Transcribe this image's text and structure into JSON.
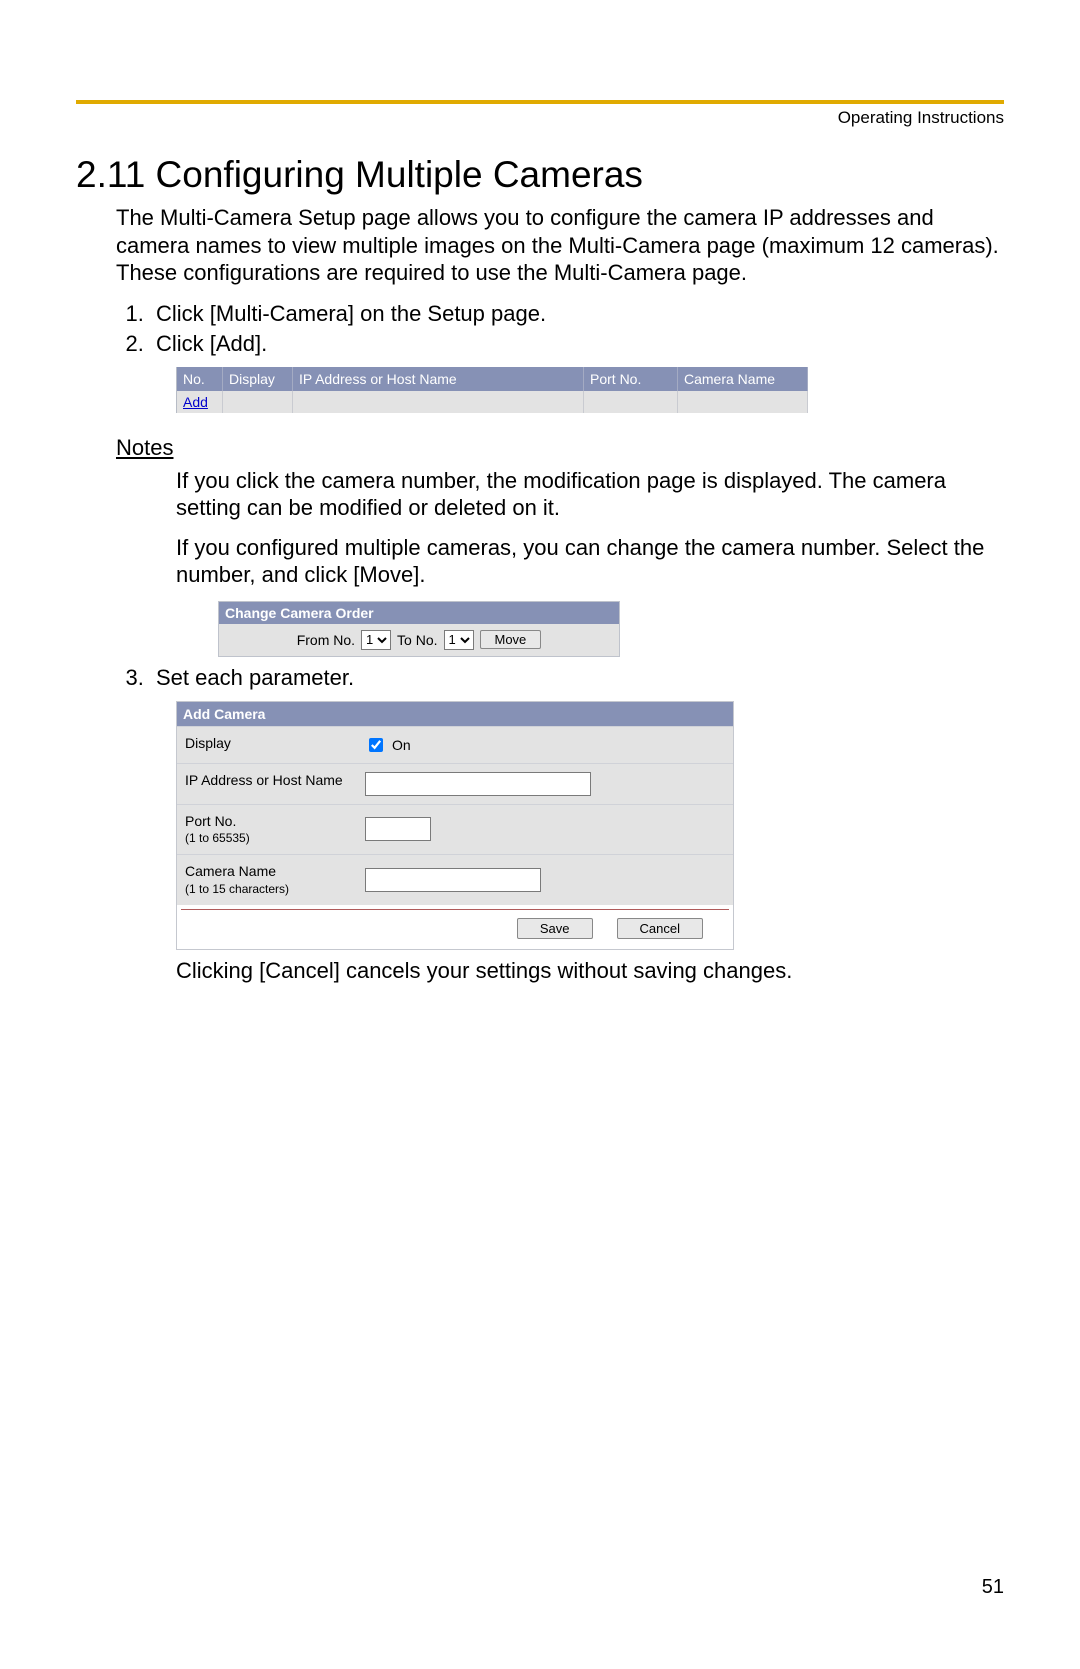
{
  "header_label": "Operating Instructions",
  "section_title": "2.11  Configuring Multiple Cameras",
  "intro": "The Multi-Camera Setup page allows you to configure the camera IP addresses and camera names to view multiple images on the Multi-Camera page (maximum 12 cameras). These configurations are required to use the Multi-Camera page.",
  "step1": "Click [Multi-Camera] on the Setup page.",
  "step2": "Click [Add].",
  "table": {
    "col_no": "No.",
    "col_display": "Display",
    "col_ip": "IP Address or Host Name",
    "col_port": "Port No.",
    "col_name": "Camera Name",
    "add_link": "Add"
  },
  "notes_heading": "Notes",
  "note1": "If you click the camera number, the modification page is displayed. The camera setting can be modified or deleted on it.",
  "note2": "If you configured multiple cameras, you can change the camera number. Select the number, and click [Move].",
  "change_order": {
    "title": "Change Camera Order",
    "from_label": "From No.",
    "to_label": "To No.",
    "from_value": "1",
    "to_value": "1",
    "move_button": "Move"
  },
  "step3": "Set each parameter.",
  "add_camera": {
    "title": "Add Camera",
    "display_label": "Display",
    "display_on": "On",
    "ip_label": "IP Address or Host Name",
    "port_label": "Port No.",
    "port_hint": "(1 to 65535)",
    "name_label": "Camera Name",
    "name_hint": "(1 to 15 characters)",
    "save": "Save",
    "cancel": "Cancel"
  },
  "cancel_footer": "Clicking [Cancel] cancels your settings without saving changes.",
  "page_number": "51"
}
